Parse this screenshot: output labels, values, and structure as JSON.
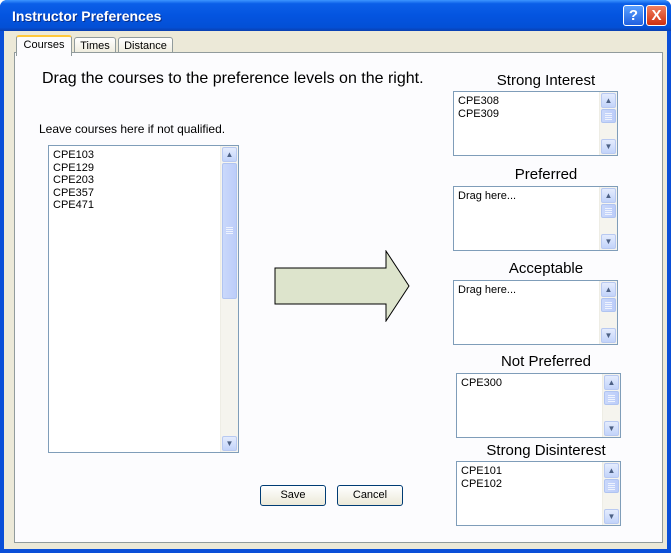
{
  "window": {
    "title": "Instructor Preferences",
    "help_glyph": "?",
    "close_glyph": "X"
  },
  "tabs": [
    {
      "label": "Courses",
      "active": true
    },
    {
      "label": "Times",
      "active": false
    },
    {
      "label": "Distance",
      "active": false
    }
  ],
  "instructions": "Drag the courses to the preference levels on the right.",
  "unassigned": {
    "label": "Leave courses here if not qualified.",
    "items": [
      "CPE103",
      "CPE129",
      "CPE203",
      "CPE357",
      "CPE471"
    ]
  },
  "preferences": [
    {
      "heading": "Strong Interest",
      "items": [
        "CPE308",
        "CPE309"
      ]
    },
    {
      "heading": "Preferred",
      "items": [
        "Drag here..."
      ]
    },
    {
      "heading": "Acceptable",
      "items": [
        "Drag here..."
      ]
    },
    {
      "heading": "Not Preferred",
      "items": [
        "CPE300"
      ]
    },
    {
      "heading": "Strong Disinterest",
      "items": [
        "CPE101",
        "CPE102"
      ]
    }
  ],
  "buttons": {
    "save": "Save",
    "cancel": "Cancel"
  },
  "scroll_glyphs": {
    "up": "▲",
    "down": "▼"
  },
  "colors": {
    "title_bar": "#0454e0",
    "arrow_fill": "#dde4cc",
    "dialog_bg": "#ece9d8"
  }
}
